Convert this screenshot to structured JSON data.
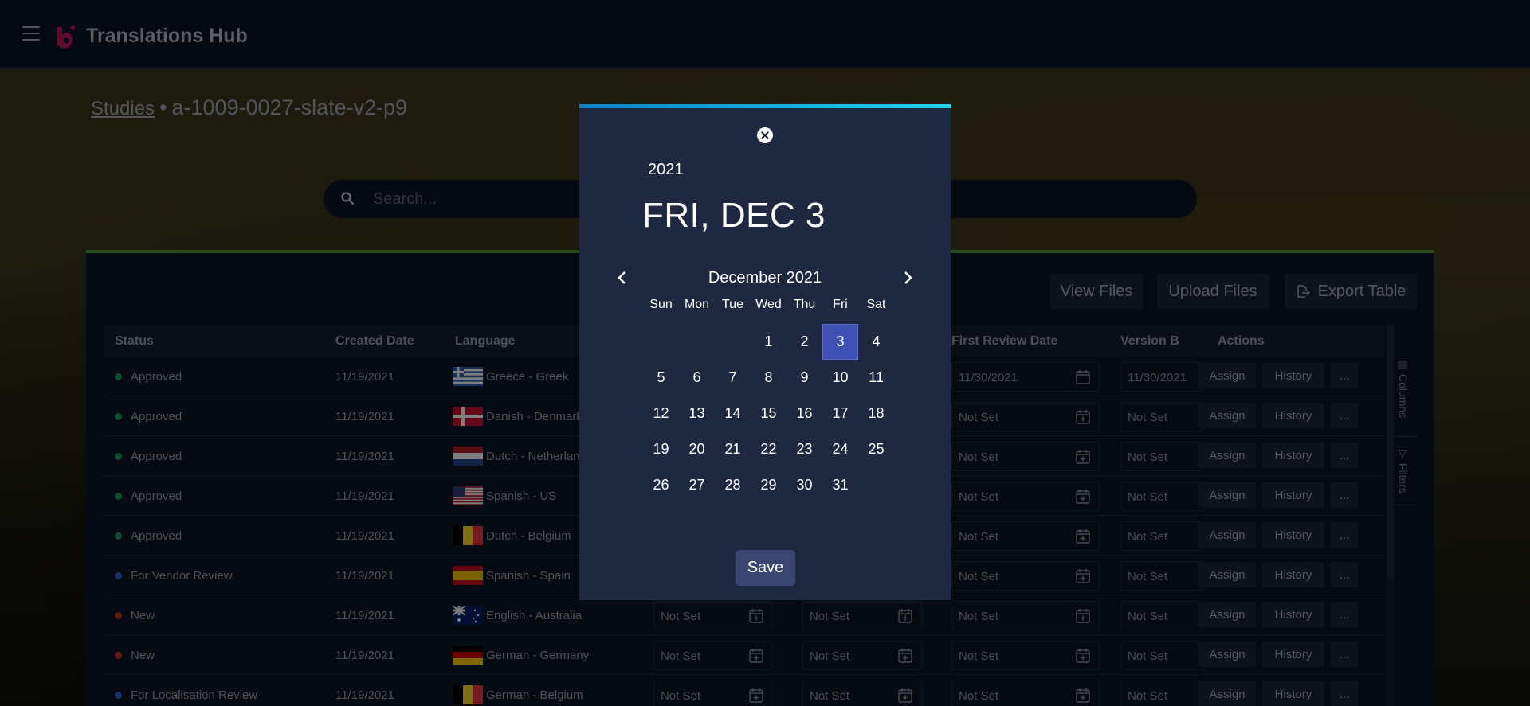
{
  "app": {
    "title": "Translations Hub"
  },
  "breadcrumb": {
    "parent": "Studies",
    "separator": "•",
    "current": "a-1009-0027-slate-v2-p9"
  },
  "search": {
    "placeholder": "Search..."
  },
  "toolbar": {
    "view_files": "View Files",
    "upload_files": "Upload Files",
    "export_table": "Export Table"
  },
  "side_rail": {
    "columns": "Columns",
    "filters": "Filters"
  },
  "table": {
    "headers": {
      "status": "Status",
      "created_date": "Created Date",
      "language": "Language",
      "first_review_date": "First Review Date",
      "version_b": "Version B",
      "actions": "Actions"
    },
    "action_labels": {
      "assign": "Assign",
      "history": "History",
      "more": "..."
    },
    "status_colors": {
      "Approved": "#1f9a5c",
      "For Vendor Review": "#3563c9",
      "New": "#c0392b",
      "For Localisation Review": "#3563c9"
    },
    "rows": [
      {
        "status": "Approved",
        "created": "11/19/2021",
        "flag": "greece",
        "language": "Greece - Greek",
        "col_a": "",
        "col_b": "",
        "first_review": "11/30/2021",
        "version_b": "11/30/2021"
      },
      {
        "status": "Approved",
        "created": "11/19/2021",
        "flag": "denmark",
        "language": "Danish - Denmark",
        "col_a": "",
        "col_b": "",
        "first_review": "Not Set",
        "version_b": "Not Set"
      },
      {
        "status": "Approved",
        "created": "11/19/2021",
        "flag": "netherlands",
        "language": "Dutch - Netherlands",
        "col_a": "",
        "col_b": "",
        "first_review": "Not Set",
        "version_b": "Not Set"
      },
      {
        "status": "Approved",
        "created": "11/19/2021",
        "flag": "us",
        "language": "Spanish - US",
        "col_a": "",
        "col_b": "",
        "first_review": "Not Set",
        "version_b": "Not Set"
      },
      {
        "status": "Approved",
        "created": "11/19/2021",
        "flag": "belgium",
        "language": "Dutch - Belgium",
        "col_a": "",
        "col_b": "",
        "first_review": "Not Set",
        "version_b": "Not Set"
      },
      {
        "status": "For Vendor Review",
        "created": "11/19/2021",
        "flag": "spain",
        "language": "Spanish - Spain",
        "col_a": "",
        "col_b": "",
        "first_review": "Not Set",
        "version_b": "Not Set"
      },
      {
        "status": "New",
        "created": "11/19/2021",
        "flag": "australia",
        "language": "English - Australia",
        "col_a": "Not Set",
        "col_b": "Not Set",
        "first_review": "Not Set",
        "version_b": "Not Set"
      },
      {
        "status": "New",
        "created": "11/19/2021",
        "flag": "germany",
        "language": "German - Germany",
        "col_a": "Not Set",
        "col_b": "Not Set",
        "first_review": "Not Set",
        "version_b": "Not Set"
      },
      {
        "status": "For Localisation Review",
        "created": "11/19/2021",
        "flag": "belgium",
        "language": "German - Belgium",
        "col_a": "Not Set",
        "col_b": "Not Set",
        "first_review": "Not Set",
        "version_b": "Not Set"
      }
    ]
  },
  "datepicker": {
    "year": "2021",
    "selected_label": "FRI, DEC 3",
    "month_label": "December 2021",
    "weekdays": [
      "Sun",
      "Mon",
      "Tue",
      "Wed",
      "Thu",
      "Fri",
      "Sat"
    ],
    "first_weekday_index": 3,
    "days_in_month": 31,
    "selected_day": 3,
    "save_label": "Save"
  },
  "colors": {
    "accent": "#3f51b5",
    "panel_top": "#4e9b3a",
    "modal_top": "#22d3e8"
  }
}
